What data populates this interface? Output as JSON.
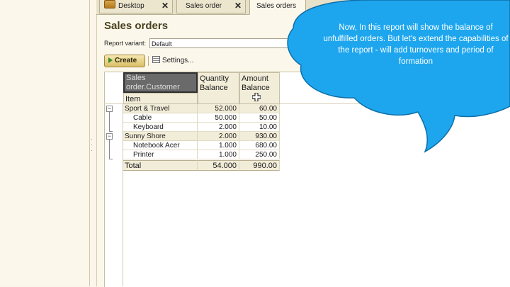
{
  "tabs": [
    {
      "label": "Desktop",
      "closable": true
    },
    {
      "label": "Sales order",
      "closable": true
    },
    {
      "label": "Sales orders",
      "active": true
    }
  ],
  "form": {
    "title": "Sales orders",
    "variant_label": "Report variant:",
    "variant_value": "Default",
    "create_label": "Create",
    "settings_label": "Settings..."
  },
  "report": {
    "row_header_line1": "Sales",
    "row_header_line2": "order.Customer",
    "row_header_sub": "Item",
    "col_qty_line1": "Quantity",
    "col_qty_line2": "Balance",
    "col_amt_line1": "Amount",
    "col_amt_line2": "Balance",
    "groups": [
      {
        "name": "Sport & Travel",
        "qty": "52.000",
        "amount": "60.00",
        "items": [
          {
            "name": "Cable",
            "qty": "50.000",
            "amount": "50.00"
          },
          {
            "name": "Keyboard",
            "qty": "2.000",
            "amount": "10.00"
          }
        ]
      },
      {
        "name": "Sunny Shore",
        "qty": "2.000",
        "amount": "930.00",
        "items": [
          {
            "name": "Notebook Acer",
            "qty": "1.000",
            "amount": "680.00"
          },
          {
            "name": "Printer",
            "qty": "1.000",
            "amount": "250.00"
          }
        ]
      }
    ],
    "total_label": "Total",
    "total_qty": "54.000",
    "total_amount": "990.00"
  },
  "callout": {
    "text": "Now, In this report will show the balance of unfulfilled orders. But let's extend the capabilities of the report - will add turnovers and period of formation",
    "color": "#1da6ee"
  },
  "icons": [
    "home-icon",
    "close-icon",
    "play-icon",
    "settings-icon",
    "collapse-icon",
    "cursor-icon"
  ]
}
